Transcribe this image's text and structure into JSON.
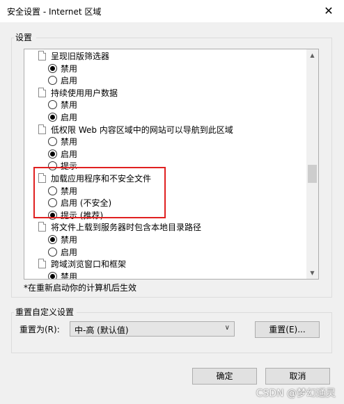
{
  "window": {
    "title": "安全设置 - Internet 区域",
    "close_glyph": "✕"
  },
  "settings_group": {
    "label": "设置"
  },
  "tree": {
    "rows": [
      {
        "kind": "category",
        "text": "呈现旧版筛选器"
      },
      {
        "kind": "option",
        "text": "禁用",
        "checked": true
      },
      {
        "kind": "option",
        "text": "启用",
        "checked": false
      },
      {
        "kind": "category",
        "text": "持续使用用户数据"
      },
      {
        "kind": "option",
        "text": "禁用",
        "checked": false
      },
      {
        "kind": "option",
        "text": "启用",
        "checked": true
      },
      {
        "kind": "category",
        "text": "低权限 Web 内容区域中的网站可以导航到此区域"
      },
      {
        "kind": "option",
        "text": "禁用",
        "checked": false
      },
      {
        "kind": "option",
        "text": "启用",
        "checked": true
      },
      {
        "kind": "option",
        "text": "提示",
        "checked": false
      },
      {
        "kind": "category",
        "text": "加载应用程序和不安全文件"
      },
      {
        "kind": "option",
        "text": "禁用",
        "checked": false
      },
      {
        "kind": "option",
        "text": "启用 (不安全)",
        "checked": false
      },
      {
        "kind": "option",
        "text": "提示 (推荐)",
        "checked": true
      },
      {
        "kind": "category",
        "text": "将文件上载到服务器时包含本地目录路径"
      },
      {
        "kind": "option",
        "text": "禁用",
        "checked": true
      },
      {
        "kind": "option",
        "text": "启用",
        "checked": false
      },
      {
        "kind": "category",
        "text": "跨域浏览窗口和框架"
      },
      {
        "kind": "option",
        "text": "禁用",
        "checked": true
      }
    ],
    "scroll_fraction": 0.55
  },
  "restart_note": "*在重新启动你的计算机后生效",
  "reset_group": {
    "label": "重置自定义设置",
    "reset_to_label": "重置为(R):",
    "selected_level": "中-高 (默认值)",
    "reset_button": "重置(E)..."
  },
  "dialog_buttons": {
    "ok": "确定",
    "cancel": "取消"
  },
  "watermark": "CSDN @梦幻通灵",
  "colors": {
    "highlight_border": "#e02020"
  }
}
